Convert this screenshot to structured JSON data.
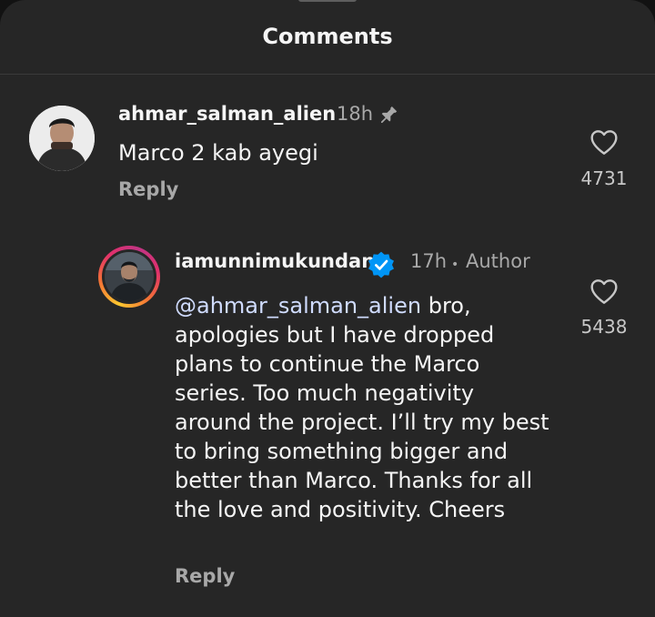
{
  "sheet": {
    "title": "Comments"
  },
  "comments": [
    {
      "username": "ahmar_salman_alien",
      "time": "18h",
      "text": "Marco 2 kab ayegi",
      "reply_label": "Reply",
      "like_count": "4731"
    }
  ],
  "reply_comment": {
    "username": "iamunnimukundan",
    "time": "17h",
    "author_label": "Author",
    "mention": "@ahmar_salman_alien",
    "text": " bro, apologies but I have dropped plans to continue the Marco series. Too much negativity around the project. I’ll try my best to bring something bigger and better than Marco. Thanks for all the love and positivity. Cheers",
    "reply_label": "Reply",
    "like_count": "5438"
  },
  "icons": {
    "pin": "pin-icon",
    "verified": "verified-badge-icon",
    "like": "heart-outline-icon"
  },
  "colors": {
    "background": "#262626",
    "verified": "#0095f6",
    "mention": "#d0dcff"
  }
}
